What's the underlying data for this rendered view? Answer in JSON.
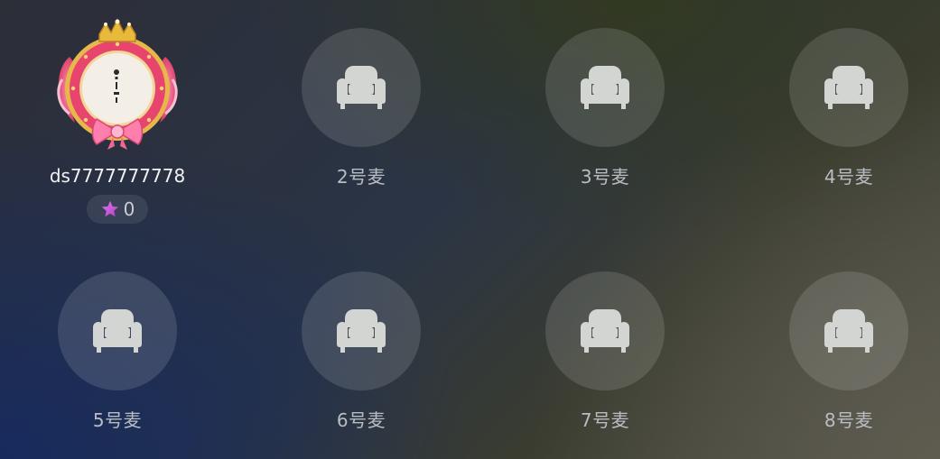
{
  "host": {
    "username": "ds7777777778",
    "score": "0",
    "avatar_icon": "crowned-avatar-frame-icon",
    "score_icon": "star-icon",
    "colors": {
      "frame_pink": "#e8456e",
      "frame_gold": "#e6b84a",
      "star": "#c855d8"
    }
  },
  "seats": [
    {
      "label": "2号麦",
      "icon": "sofa-icon"
    },
    {
      "label": "3号麦",
      "icon": "sofa-icon"
    },
    {
      "label": "4号麦",
      "icon": "sofa-icon"
    },
    {
      "label": "5号麦",
      "icon": "sofa-icon"
    },
    {
      "label": "6号麦",
      "icon": "sofa-icon"
    },
    {
      "label": "7号麦",
      "icon": "sofa-icon"
    },
    {
      "label": "8号麦",
      "icon": "sofa-icon"
    }
  ]
}
